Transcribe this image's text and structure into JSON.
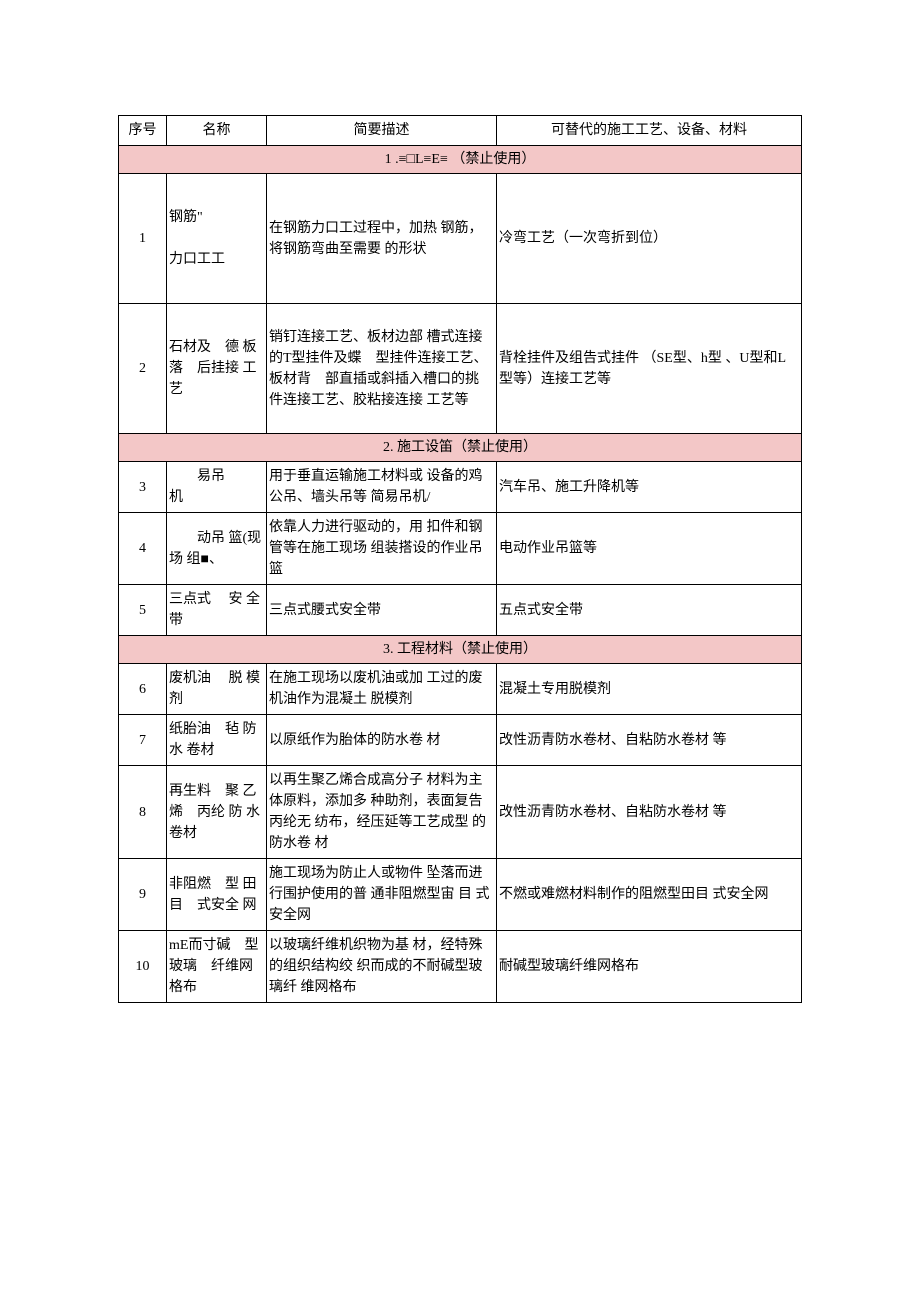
{
  "headers": {
    "idx": "序号",
    "name": "名称",
    "desc": "简要描述",
    "alt": "可替代的施工工艺、设备、材料"
  },
  "sections": [
    {
      "title": "1 .≡□L≡E≡ （禁止使用）",
      "rows": [
        {
          "idx": "1",
          "name": "钢筋\"\n\n力口工工",
          "desc": "在钢筋力口工过程中，加热 钢筋，将钢筋弯曲至需要\n的形状",
          "alt": "冷弯工艺（一次弯折到位）",
          "rowClass": "tall-1"
        },
        {
          "idx": "2",
          "name": "石材及　德 板落　后挂接 工艺",
          "desc": "销钉连接工艺、板材边部 槽式连接的T型挂件及蝶　型挂件连接工艺、板材背　部直插或斜插入槽口的挑　件连接工艺、胶粘接连接 工艺等",
          "alt": "背栓挂件及组告式挂件 （SE型、h型 、U型和L型等）连接工艺等",
          "rowClass": "tall-2"
        }
      ]
    },
    {
      "title": "2. 施工设笛（禁止使用）",
      "rows": [
        {
          "idx": "3",
          "name": "　　易吊\n机",
          "desc": "用于垂直运输施工材料或 设备的鸡公吊、墙头吊等 简易吊机/",
          "alt": "汽车吊、施工升降机等"
        },
        {
          "idx": "4",
          "name": "　　动吊 篮(现 场 组■、",
          "desc": "依靠人力进行驱动的，用 扣件和钢管等在施工现场 组装搭设的作业吊篮",
          "alt": "电动作业吊篮等"
        },
        {
          "idx": "5",
          "name": "三点式　 安 全带",
          "desc": "三点式腰式安全带",
          "alt": "五点式安全带"
        }
      ]
    },
    {
      "title": "3. 工程材料（禁止使用）",
      "rows": [
        {
          "idx": "6",
          "name": "废机油　 脱 模剂",
          "desc": "在施工现场以废机油或加 工过的废机油作为混凝土 脱模剂",
          "alt": "混凝土专用脱模剂"
        },
        {
          "idx": "7",
          "name": "纸胎油　毡 防水 卷材",
          "desc": "以原纸作为胎体的防水卷 材",
          "alt": "改性沥青防水卷材、自粘防水卷材 等"
        },
        {
          "idx": "8",
          "name": "再生料　聚 乙烯　丙纶 防 水卷材",
          "desc": "以再生聚乙烯合成高分子 材料为主体原料，添加多 种助剂，表面复告丙纶无 纺布，经压延等工艺成型 的防水卷 材",
          "alt": "改性沥青防水卷材、自粘防水卷材 等"
        },
        {
          "idx": "9",
          "name": "非阻燃　型 田目　式安全 网",
          "desc": "施工现场为防止人或物件 坠落而进行围护使用的普 通非阻燃型宙 目 式安全网",
          "alt": "不燃或难燃材料制作的阻燃型田目 式安全网"
        },
        {
          "idx": "10",
          "name": "mE而寸碱　型玻璃　纤维网 格布",
          "desc": "以玻璃纤维机织物为基 材，经特殊的组织结构绞 织而成的不耐碱型玻璃纤 维网格布",
          "alt": "耐碱型玻璃纤维网格布"
        }
      ]
    }
  ]
}
